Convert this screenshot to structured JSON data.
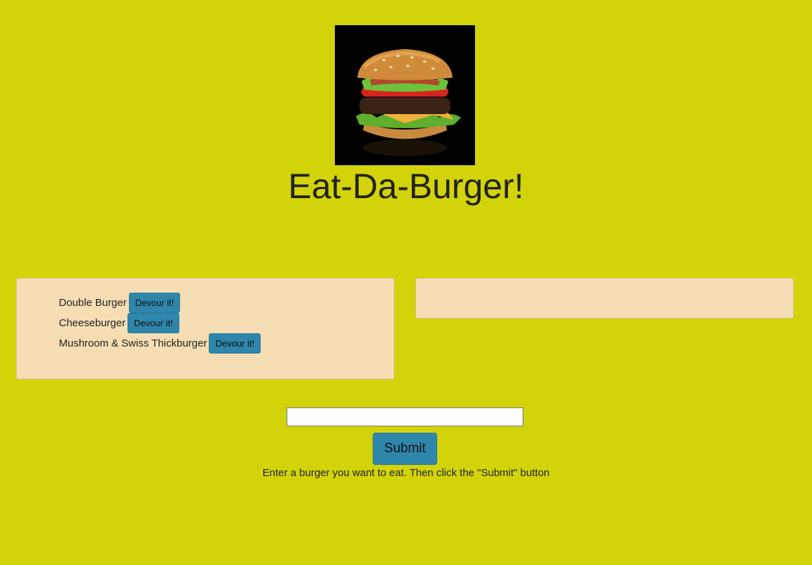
{
  "header": {
    "title": "Eat-Da-Burger!",
    "logo_icon": "burger-photo"
  },
  "burgers_to_eat": [
    {
      "name": "Double Burger",
      "button_label": "Devour it!"
    },
    {
      "name": "Cheeseburger",
      "button_label": "Devour it!"
    },
    {
      "name": "Mushroom & Swiss Thickburger",
      "button_label": "Devour it!"
    }
  ],
  "devoured_burgers": [],
  "form": {
    "input_value": "",
    "input_placeholder": "",
    "submit_label": "Submit",
    "hint": "Enter a burger you want to eat. Then click the \"Submit\" button"
  },
  "colors": {
    "background": "#d3d30a",
    "panel": "#f5deb3",
    "button": "#2e86ab"
  }
}
